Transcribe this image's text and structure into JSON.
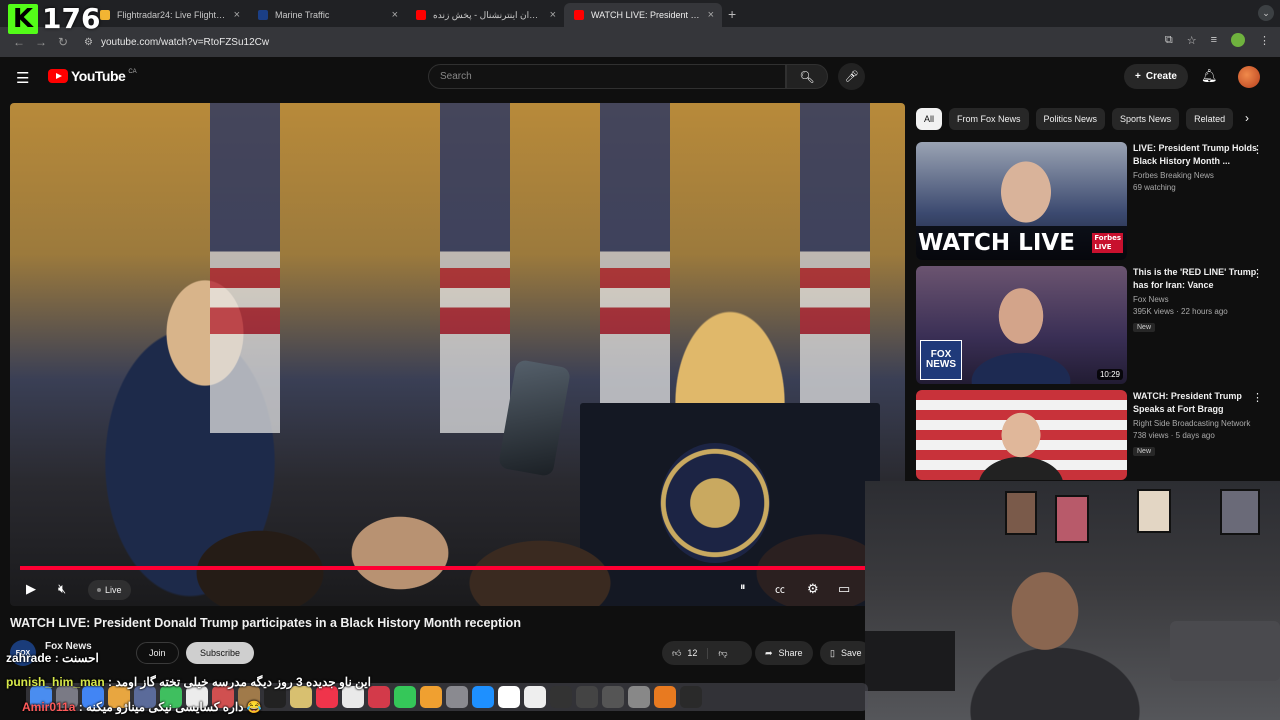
{
  "overlay": {
    "viewer_count": "176",
    "platform_logo": "K"
  },
  "browser": {
    "tabs": [
      {
        "title": "Flightradar24: Live Flight Tra",
        "favicon_color": "#f2b533"
      },
      {
        "title": "Marine Traffic",
        "favicon_color": "#1b3f86"
      },
      {
        "title": "ایران اینترنشنال - پخش زنده - YouTube",
        "favicon_color": "#ff0000"
      },
      {
        "title": "WATCH LIVE: President Dona",
        "favicon_color": "#ff0000"
      }
    ],
    "url": "youtube.com/watch?v=RtoFZSu12Cw"
  },
  "youtube": {
    "logo_text": "YouTube",
    "country_code": "CA",
    "search_placeholder": "Search",
    "create_label": "Create"
  },
  "video": {
    "live_label": "Live",
    "title": "WATCH LIVE: President Donald Trump participates in a Black History Month reception",
    "channel": "Fox News",
    "channel_avatar_text": "FOX",
    "join_label": "Join",
    "subscribe_label": "Subscribe",
    "likes": "12",
    "share_label": "Share",
    "save_label": "Save",
    "progress": 1.0
  },
  "chips": [
    "All",
    "From Fox News",
    "Politics News",
    "Sports News",
    "Related"
  ],
  "recommendations": [
    {
      "title": "LIVE: President Trump Holds Black History Month ...",
      "channel": "Forbes Breaking News",
      "meta": "69 watching",
      "badge": "",
      "duration": "",
      "overlay_text": "WATCH LIVE",
      "overlay_brand": "Forbes",
      "overlay_live": "LIVE"
    },
    {
      "title": "This is the 'RED LINE' Trump has for Iran: Vance",
      "channel": "Fox News",
      "meta": "395K views · 22 hours ago",
      "badge": "New",
      "duration": "10:29",
      "overlay_text": "",
      "logo_line1": "FOX",
      "logo_line2": "NEWS"
    },
    {
      "title": "WATCH: President Trump Speaks at Fort Bragg about...",
      "channel": "Right Side Broadcasting Network",
      "meta": "738 views · 5 days ago",
      "badge": "New",
      "duration": "",
      "overlay_text": ""
    }
  ],
  "chat": [
    {
      "user": "zahrade",
      "message": "احسنت",
      "color": "#ffffff"
    },
    {
      "user": "punish_him_man",
      "message": "این ناو جدیده 3 روز دیگه مدرسه خیلی تخته گاز اومد",
      "color": "#d7e84a"
    },
    {
      "user": "Amir011a",
      "message": "داره کسایسی نیکی میناژو میکنه 😂",
      "color": "#ff5a5a"
    }
  ]
}
